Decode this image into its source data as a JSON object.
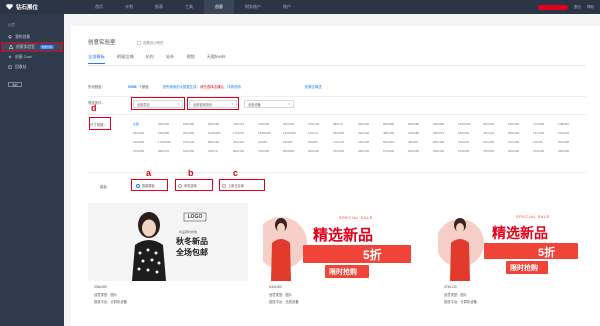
{
  "app": {
    "logo_text": "钻石展位"
  },
  "topnav": [
    {
      "label": "首页",
      "active": false
    },
    {
      "label": "计划",
      "active": false
    },
    {
      "label": "报表",
      "active": false
    },
    {
      "label": "工具",
      "active": false
    },
    {
      "label": "创意",
      "active": true
    },
    {
      "label": "财务账户",
      "active": false
    },
    {
      "label": "账户",
      "active": false
    }
  ],
  "topright": {
    "link1": "退出",
    "link2": "帮助"
  },
  "sidebar": {
    "group_label": "创意",
    "items": [
      {
        "label": "我的创意",
        "active": false,
        "icon": "location-icon"
      },
      {
        "label": "创意实验室",
        "active": true,
        "icon": "flask-icon",
        "badge": "智能创意"
      },
      {
        "label": "创意 Cool",
        "active": false,
        "icon": "sparkle-icon"
      },
      {
        "label": "回收站",
        "active": false,
        "icon": "trash-icon"
      }
    ],
    "collapse_label": "收起"
  },
  "header": {
    "title": "创意实验室",
    "subtitle": "查看设计规范"
  },
  "tabs": [
    {
      "label": "全部模板",
      "active": true
    },
    {
      "label": "明星店铺",
      "active": false
    },
    {
      "label": "站内",
      "active": false
    },
    {
      "label": "站外",
      "active": false
    },
    {
      "label": "视频",
      "active": false
    },
    {
      "label": "天猫feeds",
      "active": false
    }
  ],
  "quota_row": {
    "label": "所用额度：",
    "used": "5/598",
    "unit": "个额度",
    "notice_prefix": "您所使用的大数据生成，",
    "notice_red": "请先选择店铺后",
    "notice_suffix": "，详情说明",
    "right_link": "资源位概述"
  },
  "filters": {
    "label": "筛选条件：",
    "selects": [
      {
        "value": "全部类目"
      },
      {
        "value": "全部营销场景"
      },
      {
        "value": "全部设备"
      }
    ]
  },
  "sizes": {
    "label": "尺寸规格：",
    "items": [
      "全部",
      "640x200",
      "520x280",
      "640x250",
      "760x167",
      "726x200",
      "300x250",
      "375x130",
      "880x70",
      "640x400",
      "800x800",
      "950x285",
      "990x280",
      "1920x100",
      "200x250",
      "185x100",
      "172x500",
      "1180x65",
      "640x320",
      "640x280",
      "300x300",
      "1240x260",
      "170x270",
      "1530x250",
      "1920x600",
      "140x70",
      "360x300",
      "420x120",
      "480x160",
      "185x280",
      "250x213",
      "150x200",
      "410x122",
      "550x600",
      "137x100",
      "210x240",
      "1600x90",
      "1720x290",
      "375x130",
      "800x150",
      "400x120",
      "414x87",
      "160x80",
      "300x80",
      "170x170",
      "100x100",
      "590x210",
      "450x90",
      "950x180",
      "110x120",
      "240x300",
      "212x200",
      "100x60",
      "400x280",
      "375x250",
      "660x470",
      "510x150",
      "160x70",
      "800x120",
      "760x300",
      "800x800",
      "600x130",
      "150x300",
      "280x120",
      "575x200",
      "642x250",
      "256x100",
      "674x295",
      "750x330",
      "300x300",
      "375x150",
      "640x300"
    ]
  },
  "templates_row": {
    "label": "模板：",
    "options": [
      {
        "label": "智能模板",
        "selected": true
      },
      {
        "label": "单范选择",
        "selected": false
      },
      {
        "label": "上新日实体",
        "selected": false
      }
    ]
  },
  "markers": {
    "a": "a",
    "b": "b",
    "c": "c",
    "d": "d"
  },
  "cards": [
    {
      "size": "336x280",
      "type_label": "创意类型：图片",
      "platform_label": "投放平台：计算机设备",
      "logo_text": "LOGO",
      "headline": "秋冬新品",
      "subline": "全场包邮",
      "tagline": "新品限时抢购"
    },
    {
      "size": "640x280",
      "type_label": "创意类型：图片",
      "platform_label": "投放平台：无线设备",
      "sale_tag": "SPECIAL SALE",
      "headline": "精选新品",
      "discount": "5折",
      "button": "限时抢购"
    },
    {
      "size": "375x130",
      "type_label": "创意类型：图片",
      "platform_label": "投放平台：计算机设备",
      "sale_tag": "SPECIAL SALE",
      "headline": "精选新品",
      "discount": "5折",
      "button": "限时抢购"
    }
  ],
  "colors": {
    "accent": "#1e7bff",
    "highlight": "#e3001b",
    "topbar": "#2b3545",
    "sidebar": "#2f3b4d",
    "banner": "#f0392e"
  }
}
